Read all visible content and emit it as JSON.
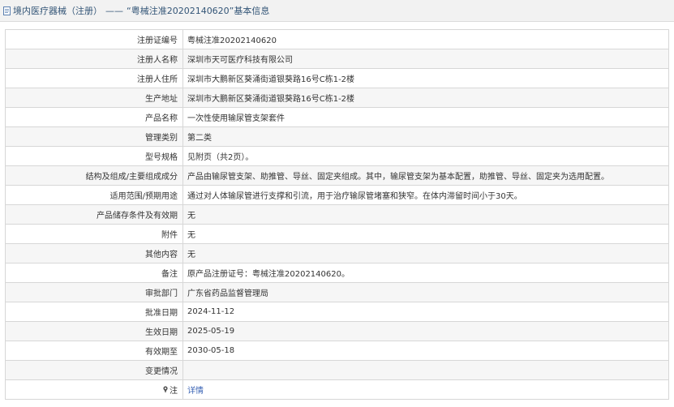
{
  "header": {
    "section": "境内医疗器械（注册）",
    "separator": "——",
    "title": "“粤械注准20202140620”基本信息"
  },
  "rows": [
    {
      "label": "注册证编号",
      "value": "粤械注准20202140620"
    },
    {
      "label": "注册人名称",
      "value": "深圳市天可医疗科技有限公司"
    },
    {
      "label": "注册人住所",
      "value": "深圳市大鹏新区葵涌街道银葵路16号C栋1-2楼"
    },
    {
      "label": "生产地址",
      "value": "深圳市大鹏新区葵涌街道银葵路16号C栋1-2楼"
    },
    {
      "label": "产品名称",
      "value": "一次性使用输尿管支架套件"
    },
    {
      "label": "管理类别",
      "value": "第二类"
    },
    {
      "label": "型号规格",
      "value": "见附页（共2页）。"
    },
    {
      "label": "结构及组成/主要组成成分",
      "value": "产品由输尿管支架、助推管、导丝、固定夹组成。其中，输尿管支架为基本配置，助推管、导丝、固定夹为选用配置。"
    },
    {
      "label": "适用范围/预期用途",
      "value": "通过对人体输尿管进行支撑和引流，用于治疗输尿管堵塞和狭窄。在体内滞留时间小于30天。"
    },
    {
      "label": "产品储存条件及有效期",
      "value": "无"
    },
    {
      "label": "附件",
      "value": "无"
    },
    {
      "label": "其他内容",
      "value": "无"
    },
    {
      "label": "备注",
      "value": "原产品注册证号：粤械注准20202140620。"
    },
    {
      "label": "审批部门",
      "value": "广东省药品监督管理局"
    },
    {
      "label": "批准日期",
      "value": "2024-11-12"
    },
    {
      "label": "生效日期",
      "value": "2025-05-19"
    },
    {
      "label": "有效期至",
      "value": "2030-05-18"
    },
    {
      "label": "变更情况",
      "value": ""
    }
  ],
  "note_row": {
    "label": "注",
    "icon": "pin-icon",
    "link_text": "详情"
  },
  "colors": {
    "header_text": "#335577",
    "link": "#3b64b5",
    "alt_row": "#f6f6f6",
    "border": "#d7d7d7"
  }
}
